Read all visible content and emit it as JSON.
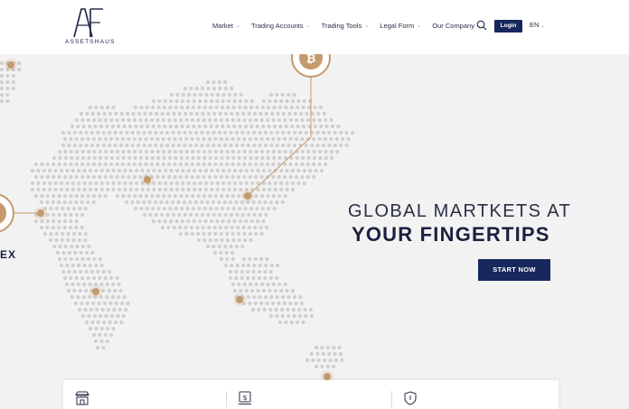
{
  "brand": {
    "logo_letters": "AF",
    "name": "ASSETSHAUS"
  },
  "nav": {
    "items": [
      {
        "label": "Market"
      },
      {
        "label": "Trading Accounts"
      },
      {
        "label": "Trading Tools"
      },
      {
        "label": "Legal Form"
      },
      {
        "label": "Our Company"
      }
    ],
    "login_label": "Login",
    "language": "EN"
  },
  "hero": {
    "headline_line1": "GLOBAL MARTKETS AT",
    "headline_line2": "YOUR FINGERTIPS",
    "cta_label": "START NOW",
    "side_label": "EX"
  },
  "icons": {
    "bitcoin": "bitcoin-icon",
    "search": "search-icon",
    "store": "store-icon",
    "money": "money-icon",
    "shield": "shield-icon"
  },
  "colors": {
    "brand_navy": "#16285c",
    "accent_gold": "#c49a6c",
    "map_dot": "#cfcfcf",
    "hero_bg": "#f2f2f2"
  }
}
